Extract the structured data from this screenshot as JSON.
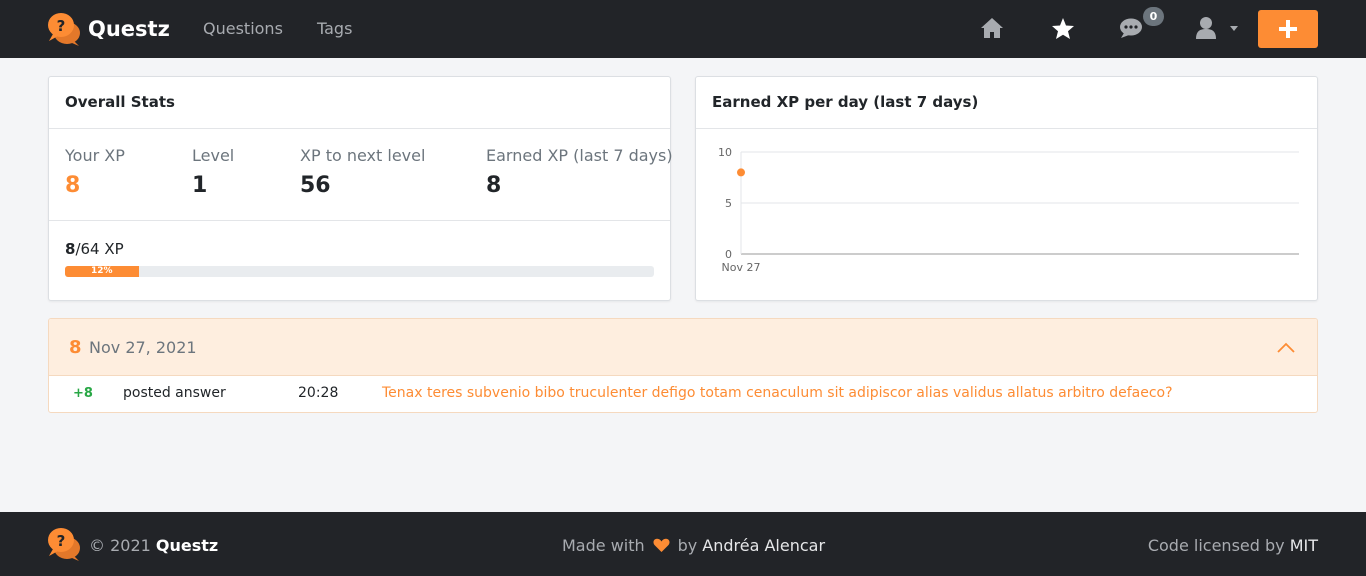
{
  "nav": {
    "brand": "Questz",
    "links": [
      "Questions",
      "Tags"
    ],
    "notifications_count": "0",
    "icons": [
      "home-icon",
      "star-icon",
      "comments-icon",
      "user-icon",
      "plus-icon"
    ]
  },
  "stats": {
    "title": "Overall Stats",
    "items": [
      {
        "label": "Your XP",
        "value": "8"
      },
      {
        "label": "Level",
        "value": "1"
      },
      {
        "label": "XP to next level",
        "value": "56"
      },
      {
        "label": "Earned XP (last 7 days)",
        "value": "8"
      }
    ],
    "progress": {
      "current": "8",
      "total_text": "/64 XP",
      "percent_label": "12%",
      "percent": 12.5
    }
  },
  "chart": {
    "title": "Earned XP per day (last 7 days)"
  },
  "chart_data": {
    "type": "line",
    "categories": [
      "Nov 27"
    ],
    "values": [
      8
    ],
    "ylim": [
      0,
      10
    ],
    "yticks": [
      0,
      5,
      10
    ],
    "grid": true,
    "color": "#fd8c34"
  },
  "activity": {
    "total": "8",
    "date": "Nov 27, 2021",
    "rows": [
      {
        "xp": "+8",
        "type": "posted answer",
        "time": "20:28",
        "title": "Tenax teres subvenio bibo truculenter defigo totam cenaculum sit adipiscor alias validus allatus arbitro defaeco?"
      }
    ]
  },
  "footer": {
    "copyright": "© 2021",
    "brand": "Questz",
    "made_with": "Made with",
    "by": "by",
    "author": "Andréa Alencar",
    "license_text": "Code licensed by",
    "license": "MIT"
  },
  "colors": {
    "accent": "#fd8c34",
    "navbar": "#222428",
    "success": "#28a745"
  }
}
